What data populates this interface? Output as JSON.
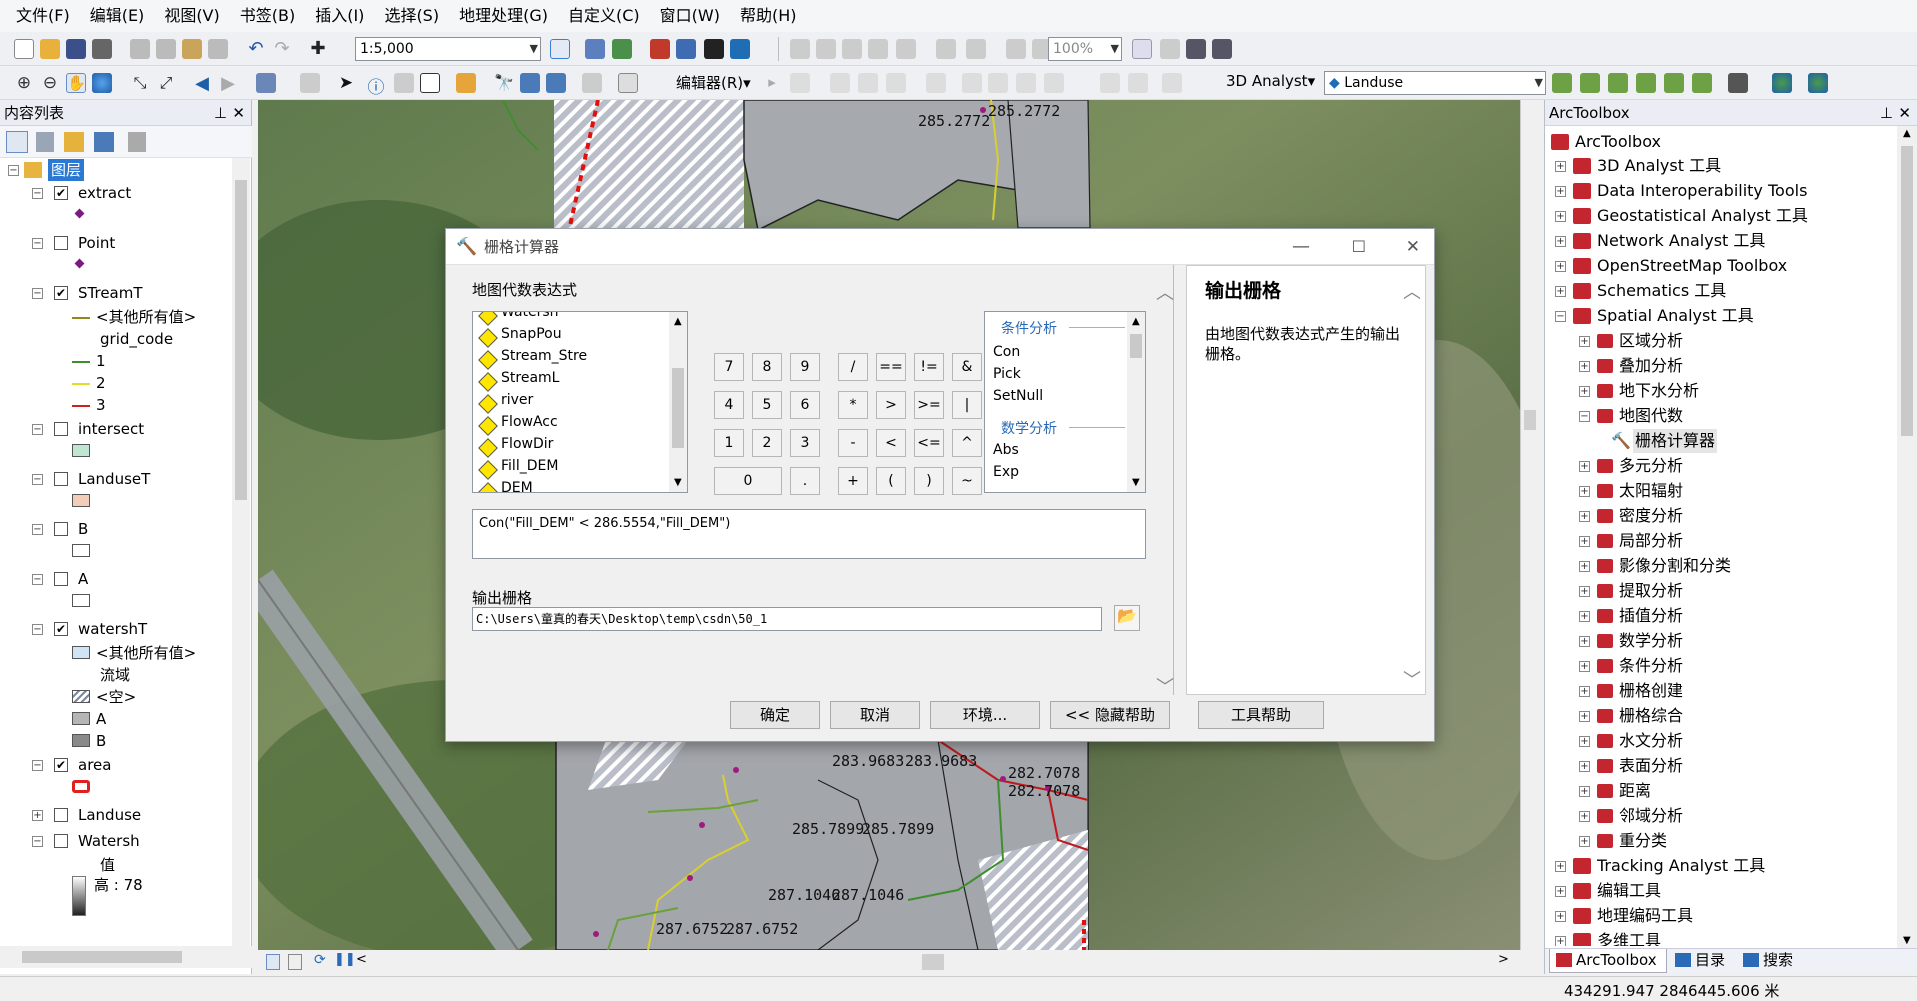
{
  "menu": [
    "文件(F)",
    "编辑(E)",
    "视图(V)",
    "书签(B)",
    "插入(I)",
    "选择(S)",
    "地理处理(G)",
    "自定义(C)",
    "窗口(W)",
    "帮助(H)"
  ],
  "toolbar": {
    "scale": "1:5,000",
    "zoom": "100%",
    "editor": "编辑器(R)▾",
    "analyst": "3D Analyst▾",
    "layer": "Landuse"
  },
  "toc": {
    "title": "内容列表",
    "root": "图层",
    "items": [
      {
        "label": "extract",
        "checked": true
      },
      {
        "label": "Point",
        "checked": false
      },
      {
        "label": "STreamT",
        "checked": true
      },
      {
        "label": "<其他所有值>"
      },
      {
        "label": "grid_code"
      },
      {
        "label": "1"
      },
      {
        "label": "2"
      },
      {
        "label": "3"
      },
      {
        "label": "intersect",
        "checked": false
      },
      {
        "label": "LanduseT",
        "checked": false
      },
      {
        "label": "B",
        "checked": false
      },
      {
        "label": "A",
        "checked": false
      },
      {
        "label": "watershT",
        "checked": true
      },
      {
        "label": "<其他所有值>"
      },
      {
        "label": "流域"
      },
      {
        "label": "<空>"
      },
      {
        "label": "A"
      },
      {
        "label": "B"
      },
      {
        "label": "area",
        "checked": true
      },
      {
        "label": "Landuse",
        "checked": false
      },
      {
        "label": "Watersh",
        "checked": false
      },
      {
        "label": "值"
      },
      {
        "label": "高 : 78"
      }
    ]
  },
  "map_labels": [
    "285.2772",
    "285.2772",
    "283.9683",
    "283.9683",
    "282.7078",
    "282.7078",
    "285.7899",
    "285.7899",
    "287.1046",
    "287.1046",
    "287.6752",
    "287.6752"
  ],
  "dialog": {
    "title": "栅格计算器",
    "expr_label": "地图代数表达式",
    "layers": [
      "Watersh",
      "SnapPou",
      "Stream_Stre",
      "StreamL",
      "river",
      "FlowAcc",
      "FlowDir",
      "Fill_DEM",
      "DEM"
    ],
    "keys": [
      "7",
      "8",
      "9",
      "/",
      "==",
      "!=",
      "&",
      "4",
      "5",
      "6",
      "*",
      ">",
      ">=",
      "|",
      "1",
      "2",
      "3",
      "-",
      "<",
      "<=",
      "^",
      "0",
      ".",
      "+",
      "(",
      ")",
      "~"
    ],
    "func_cat1": "条件分析",
    "funcs1": [
      "Con",
      "Pick",
      "SetNull"
    ],
    "func_cat2": "数学分析",
    "funcs2": [
      "Abs",
      "Exp"
    ],
    "expression": "Con(\"Fill_DEM\" < 286.5554,\"Fill_DEM\")",
    "output_label": "输出栅格",
    "output_path": "C:\\Users\\童真的春天\\Desktop\\temp\\csdn\\50_1",
    "help_title": "输出栅格",
    "help_text": "由地图代数表达式产生的输出栅格。",
    "buttons": [
      "确定",
      "取消",
      "环境...",
      "<< 隐藏帮助",
      "工具帮助"
    ]
  },
  "toolbox": {
    "title": "ArcToolbox",
    "root": "ArcToolbox",
    "items": [
      "3D Analyst 工具",
      "Data Interoperability Tools",
      "Geostatistical Analyst 工具",
      "Network Analyst 工具",
      "OpenStreetMap Toolbox",
      "Schematics 工具",
      "Spatial Analyst 工具"
    ],
    "sa_items": [
      "区域分析",
      "叠加分析",
      "地下水分析",
      "地图代数",
      "栅格计算器",
      "多元分析",
      "太阳辐射",
      "密度分析",
      "局部分析",
      "影像分割和分类",
      "提取分析",
      "插值分析",
      "数学分析",
      "条件分析",
      "栅格创建",
      "栅格综合",
      "水文分析",
      "表面分析",
      "距离",
      "邻域分析",
      "重分类"
    ],
    "tail": [
      "Tracking Analyst 工具",
      "编辑工具",
      "地理编码工具",
      "多维工具"
    ],
    "tabs": [
      "ArcToolbox",
      "目录",
      "搜索"
    ]
  },
  "status": {
    "coords": "434291.947  2846445.606 米"
  }
}
